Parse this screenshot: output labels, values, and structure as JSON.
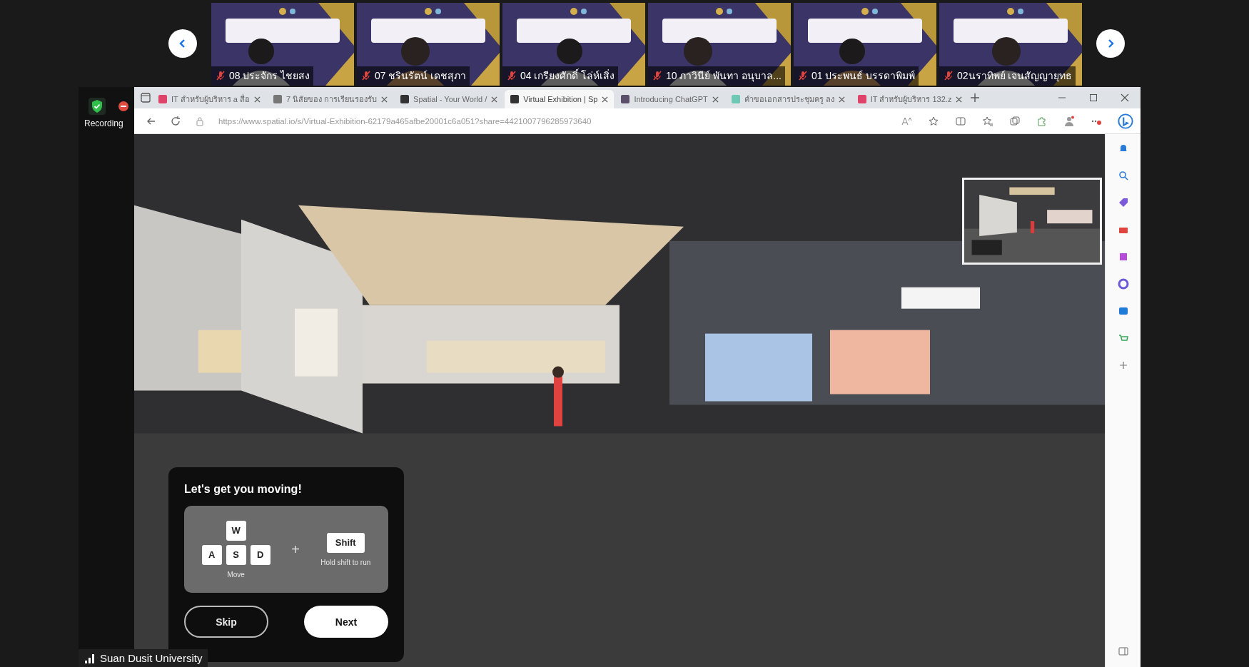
{
  "participants": [
    {
      "name": "08 ประจักร ไชยสง",
      "muted": true
    },
    {
      "name": "07 ชรินรัตน์ เดชสุภา",
      "muted": true
    },
    {
      "name": "04 เกรียงศักดิ์  โล่ห์เสิ่ง",
      "muted": true
    },
    {
      "name": "10 ภาวินีย์  พันทา อนุบาล...",
      "muted": true
    },
    {
      "name": "01 ประพนธ์ บรรดาพิมพ์",
      "muted": true
    },
    {
      "name": "02นราทิพย์ เจนสัญญายุทธ",
      "muted": true
    }
  ],
  "recording_label": "Recording",
  "browser": {
    "tabs": [
      {
        "title": "IT สำหรับผู้บริหาร a สื่อ",
        "selected": false
      },
      {
        "title": "7 นิสัยของ การเรียนรองรับ",
        "selected": false
      },
      {
        "title": "Spatial - Your World /",
        "selected": false
      },
      {
        "title": "Virtual Exhibition | Sp",
        "selected": true
      },
      {
        "title": "Introducing ChatGPT",
        "selected": false
      },
      {
        "title": "คำขอเอกสารประชุมครู ลง",
        "selected": false
      },
      {
        "title": "IT สำหรับผู้บริหาร 132.z",
        "selected": false
      }
    ],
    "url": "https://www.spatial.io/s/Virtual-Exhibition-62179a465afbe20001c6a051?share=4421007796285973640"
  },
  "tutorial": {
    "title": "Let's get you moving!",
    "move_keys": [
      "W",
      "A",
      "S",
      "D"
    ],
    "move_label": "Move",
    "plus": "+",
    "run_key": "Shift",
    "run_label": "Hold shift to run",
    "buttons": [
      {
        "label": "Skip",
        "kind": "outline"
      },
      {
        "label": "Next",
        "kind": "filled"
      }
    ]
  },
  "connection_label": "Suan Dusit University"
}
